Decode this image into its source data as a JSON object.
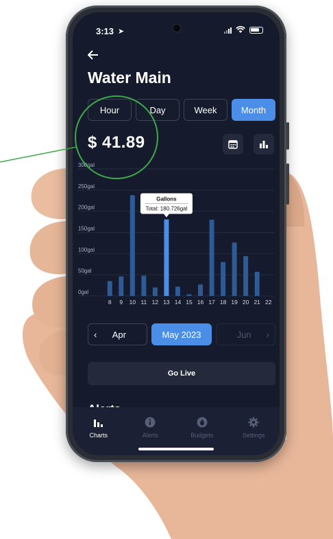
{
  "status": {
    "time": "3:13"
  },
  "header": {
    "back_icon": "arrow-left-icon",
    "title": "Water Main"
  },
  "range_tabs": [
    {
      "label": "Hour",
      "active": false
    },
    {
      "label": "Day",
      "active": false
    },
    {
      "label": "Week",
      "active": false
    },
    {
      "label": "Month",
      "active": true
    }
  ],
  "summary": {
    "amount": "$ 41.89"
  },
  "toolbar": {
    "calendar_icon": "calendar-icon",
    "bar_chart_icon": "bar-chart-icon"
  },
  "chart_data": {
    "type": "bar",
    "categories": [
      "8",
      "9",
      "10",
      "11",
      "12",
      "13",
      "14",
      "15",
      "16",
      "17",
      "18",
      "19",
      "20",
      "21",
      "22"
    ],
    "series": [
      {
        "name": "Gallons",
        "values": [
          35,
          46,
          238,
          48,
          20,
          180.726,
          22,
          4,
          27,
          180,
          80,
          126,
          94,
          57,
          0
        ]
      }
    ],
    "ylim": [
      0,
      300
    ],
    "yticks": [
      "0gal",
      "50gal",
      "100gal",
      "150gal",
      "200gal",
      "250gal",
      "300gal"
    ],
    "tooltip": {
      "title": "Gallons",
      "text": "Total: 180.726gal",
      "index": 5
    },
    "highlight_color": "#4a8ee8",
    "bar_color": "#2e5a95",
    "grid": true
  },
  "month_nav": {
    "prev": "Apr",
    "current": "May 2023",
    "next": "Jun"
  },
  "go_live": {
    "label": "Go Live"
  },
  "section_peek": {
    "label": "Alerts"
  },
  "bottom_nav": [
    {
      "label": "Charts",
      "icon": "bar-chart-icon",
      "active": true
    },
    {
      "label": "Alerts",
      "icon": "info-icon",
      "active": false
    },
    {
      "label": "Budgets",
      "icon": "water-drop-icon",
      "active": false
    },
    {
      "label": "Settings",
      "icon": "gear-icon",
      "active": false
    }
  ],
  "colors": {
    "accent": "#4a8ee8",
    "background": "#151a2c",
    "annotation": "#3daa4a"
  }
}
